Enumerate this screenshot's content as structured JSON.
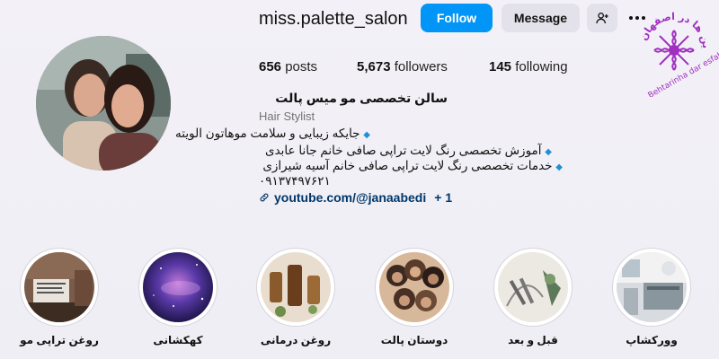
{
  "profile": {
    "username": "miss.palette_salon",
    "follow_label": "Follow",
    "message_label": "Message",
    "suggest_icon": "person-add-icon",
    "more_icon": "more-horizontal-icon"
  },
  "stats": {
    "posts_count": "656",
    "posts_label": "posts",
    "followers_count": "5,673",
    "followers_label": "followers",
    "following_count": "145",
    "following_label": "following"
  },
  "bio": {
    "name": "سالن تخصصی مو میس پالت",
    "category": "Hair Stylist",
    "lines": [
      "جایکه زیبایی و سلامت موهاتون الویته",
      "آموزش تخصصی رنگ لایت تراپی صافی خانم جانا عابدی",
      "خدمات تخصصی رنگ لایت تراپی صافی خانم آسیه شیرازی"
    ],
    "bullet": "◆",
    "phone": "۰۹۱۳۷۴۹۷۶۲۱",
    "link_text": "youtube.com/@janaabedi",
    "link_more": "+ 1",
    "link_icon": "link-icon"
  },
  "watermark": {
    "text": "بهترین ها در اصفهان"
  },
  "highlights": [
    {
      "label": "روغن تراپی مو"
    },
    {
      "label": "کهکشانی"
    },
    {
      "label": "روغن درمانی"
    },
    {
      "label": "دوستان پالت"
    },
    {
      "label": "قبل و بعد"
    },
    {
      "label": "وورکشاپ"
    }
  ],
  "colors": {
    "primary": "#0095f6",
    "secondary_button": "#e3e2ea",
    "link": "#00376b",
    "bullet": "#1f8fd6",
    "watermark": "#a02fc2"
  }
}
